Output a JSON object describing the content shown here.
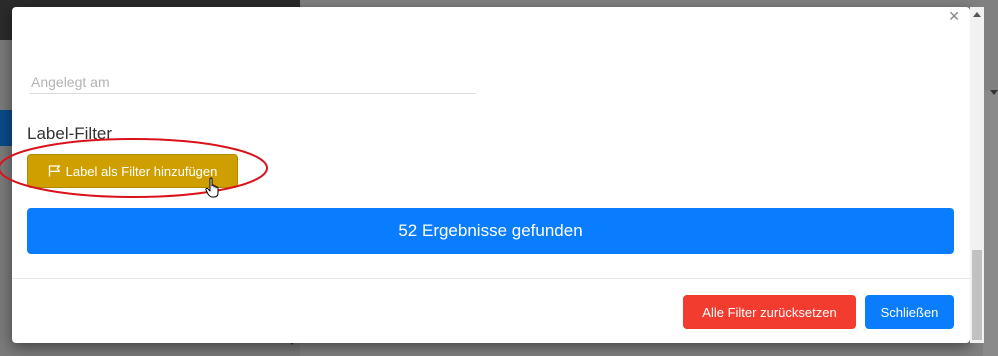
{
  "modal": {
    "close_glyph": "✕",
    "date_field": {
      "placeholder": "Angelegt am",
      "value": ""
    },
    "label_filter": {
      "heading": "Label-Filter",
      "button_label": "Label als Filter hinzufügen",
      "button_color": "#cf9f00",
      "icon": "flag-icon"
    },
    "results_button_label": "52 Ergebnisse gefunden",
    "footer": {
      "reset_label": "Alle Filter zurücksetzen",
      "close_label": "Schließen"
    }
  },
  "colors": {
    "primary": "#0a7dff",
    "danger": "#f23c2f",
    "warning": "#cf9f00",
    "annotation": "#d9121b"
  }
}
